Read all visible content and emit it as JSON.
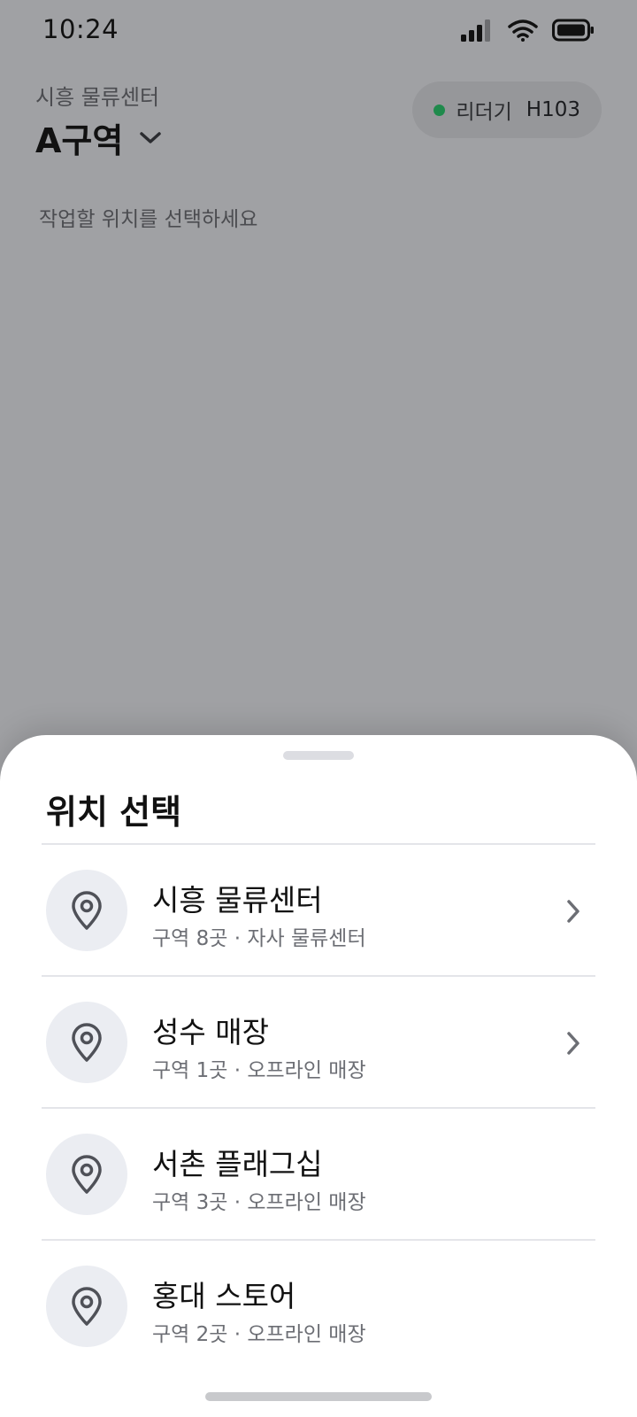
{
  "status_bar": {
    "time": "10:24",
    "signal_icon": "signal-icon",
    "wifi_icon": "wifi-icon",
    "battery_icon": "battery-icon"
  },
  "header": {
    "subtitle": "시흥 물류센터",
    "zone": "A구역",
    "device_label": "리더기",
    "device_id": "H103",
    "device_status_color": "#1f8a4c"
  },
  "instruction": "작업할 위치를 선택하세요",
  "sheet": {
    "title": "위치 선택",
    "items": [
      {
        "name": "시흥 물류센터",
        "desc": "구역 8곳 · 자사 물류센터",
        "has_chevron": true
      },
      {
        "name": "성수 매장",
        "desc": "구역 1곳 · 오프라인 매장",
        "has_chevron": true
      },
      {
        "name": "서촌 플래그십",
        "desc": "구역 3곳 · 오프라인 매장",
        "has_chevron": false
      },
      {
        "name": "홍대 스토어",
        "desc": "구역 2곳 · 오프라인 매장",
        "has_chevron": false
      }
    ]
  }
}
